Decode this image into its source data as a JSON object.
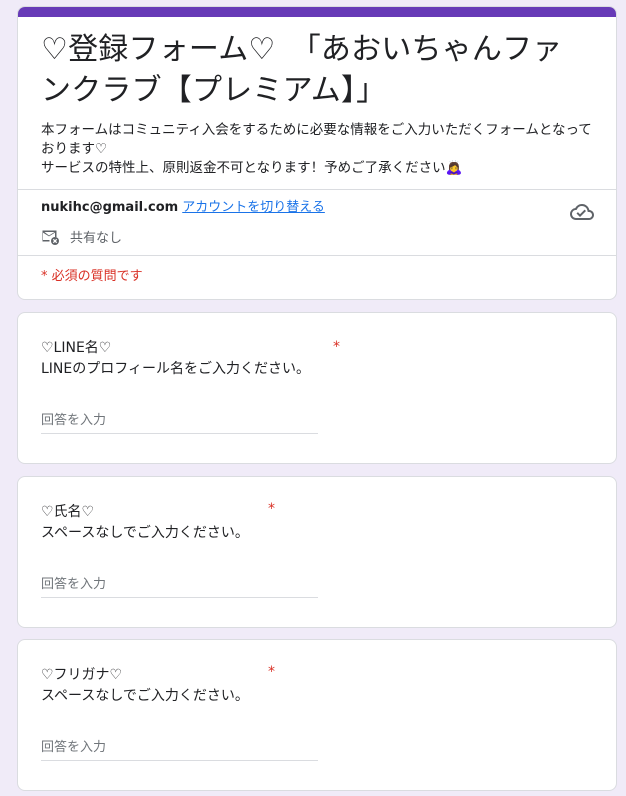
{
  "form": {
    "title": "♡登録フォーム♡　「あおいちゃんファンクラブ【プレミアム】」",
    "description": "本フォームはコミュニティ入会をするために必要な情報をご入力いただくフォームとなっております♡\nサービスの特性上、原則返金不可となります！予めご了承ください🙇‍♀️",
    "accent_color": "#673ab7",
    "background_color": "#f0ebf8"
  },
  "account": {
    "email": "nukihc@gmail.com",
    "switch_label": "アカウントを切り替える",
    "share_status": "共有なし",
    "cloud_icon": "cloud-check-icon",
    "mail_icon": "mail-block-icon"
  },
  "required_note": "* 必須の質問です",
  "required_color": "#d93025",
  "questions": [
    {
      "title": "♡LINE名♡",
      "required_mark": "*",
      "description": "LINEのプロフィール名をご入力ください。",
      "placeholder": "回答を入力"
    },
    {
      "title": "♡氏名♡",
      "required_mark": "*",
      "description": "スペースなしでご入力ください。",
      "placeholder": "回答を入力"
    },
    {
      "title": "♡フリガナ♡",
      "required_mark": "*",
      "description": "スペースなしでご入力ください。",
      "placeholder": "回答を入力"
    }
  ]
}
